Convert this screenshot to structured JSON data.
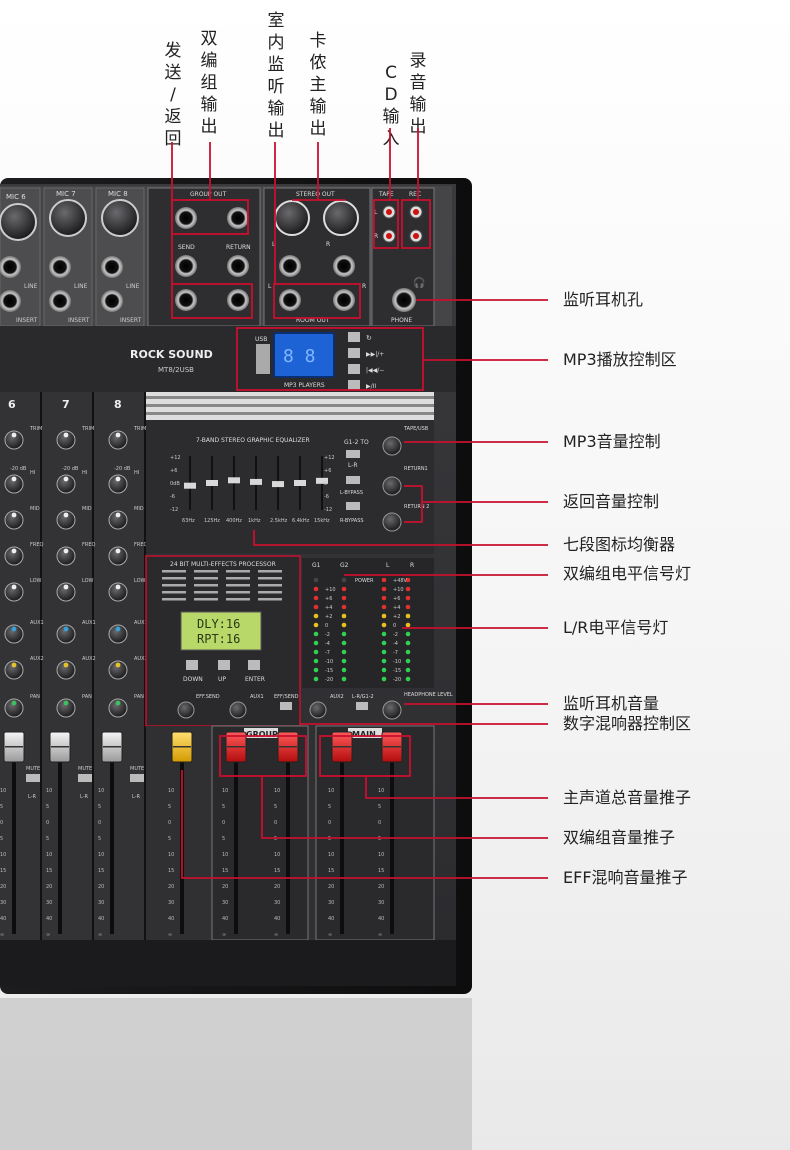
{
  "top_labels": [
    {
      "id": "send-return",
      "text": "发送/返回"
    },
    {
      "id": "group-out",
      "text": "双编组输出"
    },
    {
      "id": "room-out",
      "text": "室内监听输出"
    },
    {
      "id": "stereo-out",
      "text": "卡侬主输出"
    },
    {
      "id": "cd-in",
      "text": "CD输入"
    },
    {
      "id": "rec-out",
      "text": "录音输出"
    }
  ],
  "side_labels": [
    {
      "id": "phone-jack",
      "text": "监听耳机孔"
    },
    {
      "id": "mp3-control",
      "text": "MP3播放控制区"
    },
    {
      "id": "mp3-volume",
      "text": "MP3音量控制"
    },
    {
      "id": "return-volume",
      "text": "返回音量控制"
    },
    {
      "id": "seven-band-eq",
      "text": "七段图标均衡器"
    },
    {
      "id": "group-meter",
      "text": "双编组电平信号灯"
    },
    {
      "id": "lr-meter",
      "text": "L/R电平信号灯"
    },
    {
      "id": "phone-volume",
      "text": "监听耳机音量"
    },
    {
      "id": "dsp-area",
      "text": "数字混响器控制区"
    },
    {
      "id": "main-fader",
      "text": "主声道总音量推子"
    },
    {
      "id": "group-fader",
      "text": "双编组音量推子"
    },
    {
      "id": "eff-fader",
      "text": "EFF混响音量推子"
    }
  ],
  "panel": {
    "mic_labels": [
      "MIC 6",
      "MIC 7",
      "MIC 8"
    ],
    "line": "LINE",
    "insert": "INSERT",
    "group_out": "GROUP OUT",
    "send": "SEND",
    "return": "RETURN",
    "stereo_out": "STEREO OUT",
    "room_out": "ROOM OUT",
    "tape": "TAPE",
    "rec": "REC",
    "phone": "PHONE",
    "l": "L",
    "r": "R",
    "brand": "ROCK SOUND",
    "model": "MT8/2USB",
    "usb": "USB",
    "mp3_players": "MP3 PLAYERS",
    "channel_numbers": [
      "6",
      "7",
      "8"
    ],
    "trim": "TRIM",
    "hi": "HI",
    "mid": "MID",
    "freq": "FREQ",
    "low": "LOW",
    "aux1": "AUX1",
    "aux2": "AUX2",
    "pan": "PAN",
    "mute": "MUTE",
    "eq_title": "7-BAND STEREO GRAPHIC EQUALIZER",
    "eq_freqs": [
      "63Hz",
      "125Hz",
      "400Hz",
      "1kHz",
      "2.5kHz",
      "6.4kHz",
      "15kHz"
    ],
    "eq_scale": [
      "+12",
      "+6",
      "0dB",
      "-6",
      "-12"
    ],
    "eq_scale_r": [
      "+12",
      "+6",
      "0",
      "-6",
      "-12"
    ],
    "g1_g2": "G1-2 TO",
    "lr": "L-R",
    "l_bypass": "L-BYPASS",
    "r_bypass": "R-BYPASS",
    "tape_usb": "TAPE/USB",
    "return1": "RETURN1",
    "return2": "RETURN 2",
    "dsp_title": "24 BIT MULTI-EFFECTS PROCESSOR",
    "dsp_lcd_1": "DLY:16",
    "dsp_lcd_2": "RPT:16",
    "down": "DOWN",
    "up": "UP",
    "enter": "ENTER",
    "meter_g1": "G1",
    "meter_g2": "G2",
    "meter_power": "POWER",
    "meter_levels": [
      "+48V",
      "+10",
      "+6",
      "+4",
      "+2",
      "0",
      "-2",
      "-4",
      "-7",
      "-10",
      "-15",
      "-20"
    ],
    "group": "GROUP",
    "main": "MAIN",
    "eff_send": "EFF.SEND",
    "aux1_r": "AUX1",
    "eff_send2": "EFF/SEND",
    "aux2_r": "AUX2",
    "l_r_g1_2": "L-R/G1-2",
    "phone_level": "HEADPHONE LEVEL",
    "trim_20db": "-20 dB",
    "fader_scale": [
      "10",
      "5",
      "0",
      "5",
      "10",
      "15",
      "20",
      "30",
      "40",
      "∞"
    ]
  },
  "colors": {
    "annotation_red": "#c8102e",
    "panel_dark": "#2a2a2c",
    "panel_mid": "#3b3b3e",
    "fader_red": "#e02020",
    "fader_yellow": "#f2c21a",
    "lcd_green": "#b9d86a",
    "mp3_blue": "#1e63d6"
  }
}
